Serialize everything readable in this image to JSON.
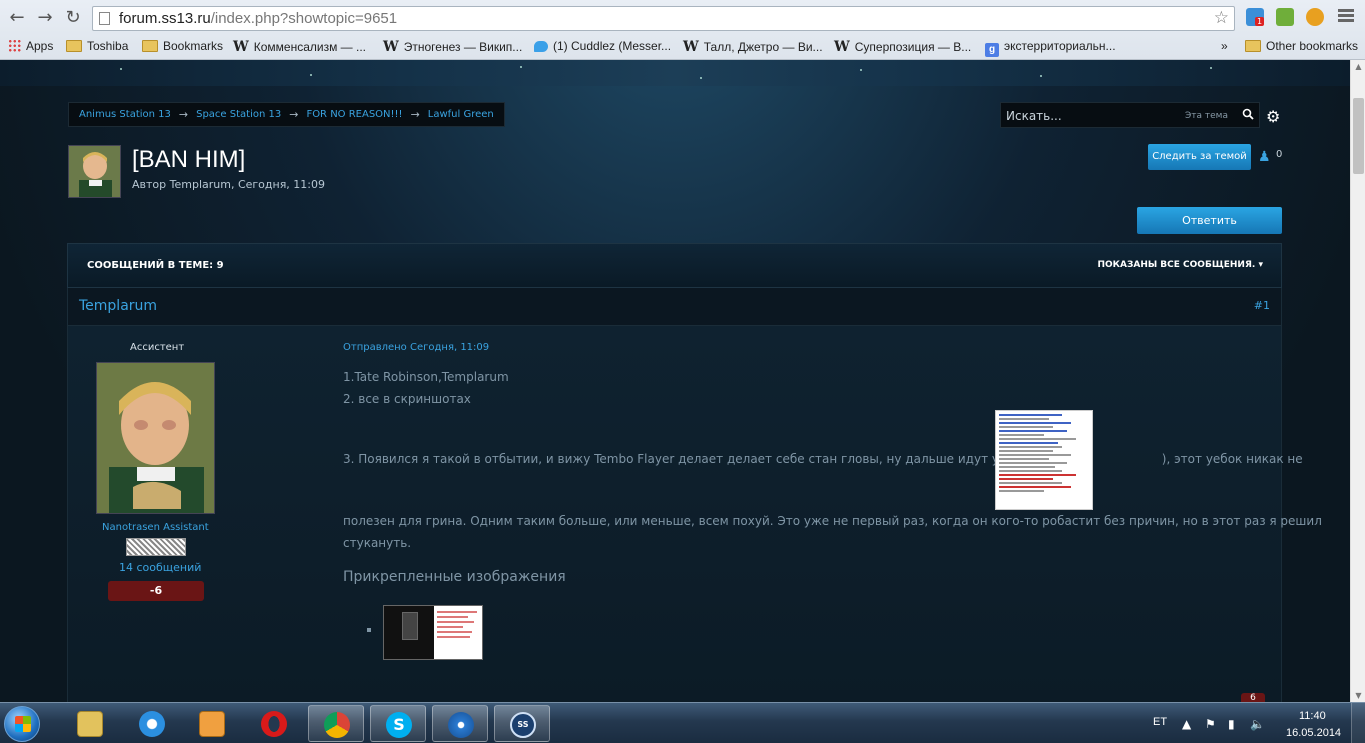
{
  "browser": {
    "url_host": "forum.ss13.ru",
    "url_path": "/index.php?showtopic=9651",
    "bookmarks": [
      {
        "label": "Apps",
        "icon": "apps-grid-icon"
      },
      {
        "label": "Toshiba",
        "icon": "folder-icon"
      },
      {
        "label": "Bookmarks",
        "icon": "folder-icon"
      },
      {
        "label": "Комменсализм — ...",
        "icon": "wikipedia-icon"
      },
      {
        "label": "Этногенез — Викип...",
        "icon": "wikipedia-icon"
      },
      {
        "label": "(1) Cuddlez (Messer...",
        "icon": "twitter-icon"
      },
      {
        "label": "Талл, Джетро — Ви...",
        "icon": "wikipedia-icon"
      },
      {
        "label": "Суперпозиция — В...",
        "icon": "wikipedia-icon"
      },
      {
        "label": "экстерриториальн...",
        "icon": "google-icon"
      }
    ],
    "overflow": "»",
    "other_bookmarks": "Other bookmarks",
    "ext_badge": "1"
  },
  "breadcrumb": [
    "Animus Station 13",
    "Space Station 13",
    "FOR NO REASON!!!",
    "Lawful Green"
  ],
  "search": {
    "placeholder": "Искать...",
    "scope": "Эта тема"
  },
  "topic": {
    "title": "[BAN HIM]",
    "meta": "Автор Templarum, Сегодня, 11:09",
    "follow_label": "Следить за темой",
    "followers": "0",
    "reply_label": "Ответить",
    "posts_count": "СООБЩЕНИЙ В ТЕМЕ: 9",
    "filter_label": "ПОКАЗАНЫ ВСЕ СООБЩЕНИЯ."
  },
  "post": {
    "author": "Templarum",
    "number": "#1",
    "group": "Ассистент",
    "user_title": "Nanotrasen Assistant",
    "post_count": "14 сообщений",
    "reputation": "-6",
    "date": "Отправлено Сегодня, 11:09",
    "line1": "1.Tate Robinson,Templarum",
    "line2": "2. все в скриншотах",
    "line3a": "3. Появился я такой в отбытии, и вижу Tembo Flayer делает делает себе стан гловы, ну дальше идут уже логи(",
    "line3b": "), этот уебок никак не",
    "line4": "полезен для грина. Одним таким больше, или меньше, всем похуй. Это уже не первый раз, когда он кого-то робастит без причин, но в этот раз я решил",
    "line5": "стукануть.",
    "attachments_heading": "Прикрепленные изображения",
    "next_badge": "6"
  },
  "taskbar": {
    "lang": "ET",
    "time": "11:40",
    "date": "16.05.2014"
  },
  "colors": {
    "link": "#3aa3e0",
    "button": "#1f8fd0",
    "negative_rep": "#6a1515"
  }
}
